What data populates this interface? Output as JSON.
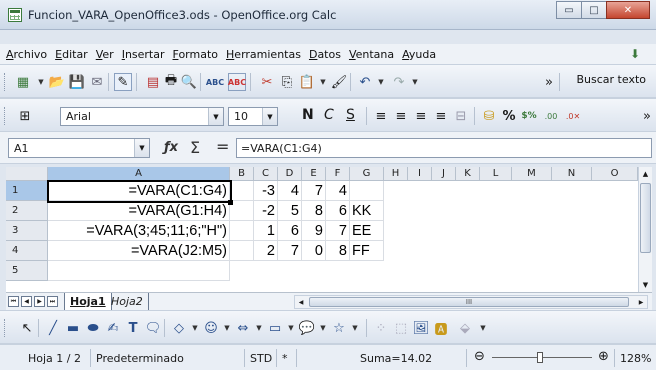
{
  "window": {
    "title": "Funcion_VARA_OpenOffice3.ods - OpenOffice.org Calc",
    "minimize": "▭",
    "maximize": "□",
    "close": "✕"
  },
  "menu": [
    "Archivo",
    "Editar",
    "Ver",
    "Insertar",
    "Formato",
    "Herramientas",
    "Datos",
    "Ventana",
    "Ayuda"
  ],
  "toolbar": {
    "search_label": "Buscar texto",
    "font_name": "Arial",
    "font_size": "10",
    "bold": "N",
    "italic": "C",
    "underline": "S"
  },
  "formula_bar": {
    "cell_ref": "A1",
    "formula": "=VARA(C1:G4)"
  },
  "grid": {
    "columns": [
      "A",
      "B",
      "C",
      "D",
      "E",
      "F",
      "G",
      "H",
      "I",
      "J",
      "K",
      "L",
      "M",
      "N",
      "O"
    ],
    "rows": [
      "1",
      "2",
      "3",
      "4",
      "5"
    ],
    "cells": [
      [
        "=VARA(C1:G4)",
        "",
        "-3",
        "4",
        "7",
        "4",
        ""
      ],
      [
        "=VARA(G1:H4)",
        "",
        "-2",
        "5",
        "8",
        "6",
        "KK"
      ],
      [
        "=VARA(3;45;11;6;\"H\")",
        "",
        "1",
        "6",
        "9",
        "7",
        "EE"
      ],
      [
        "=VARA(J2:M5)",
        "",
        "2",
        "7",
        "0",
        "8",
        "FF"
      ],
      [
        "",
        "",
        "",
        "",
        "",
        "",
        ""
      ]
    ]
  },
  "sheets": {
    "active": "Hoja1",
    "other": "Hoja2",
    "scroll_marker": "III"
  },
  "status": {
    "page": "Hoja 1 / 2",
    "style": "Predeterminado",
    "mode": "STD",
    "modified": "*",
    "sum": "Suma=14.02",
    "zoom": "128%",
    "zoom_minus": "⊖",
    "zoom_plus": "⊕"
  }
}
